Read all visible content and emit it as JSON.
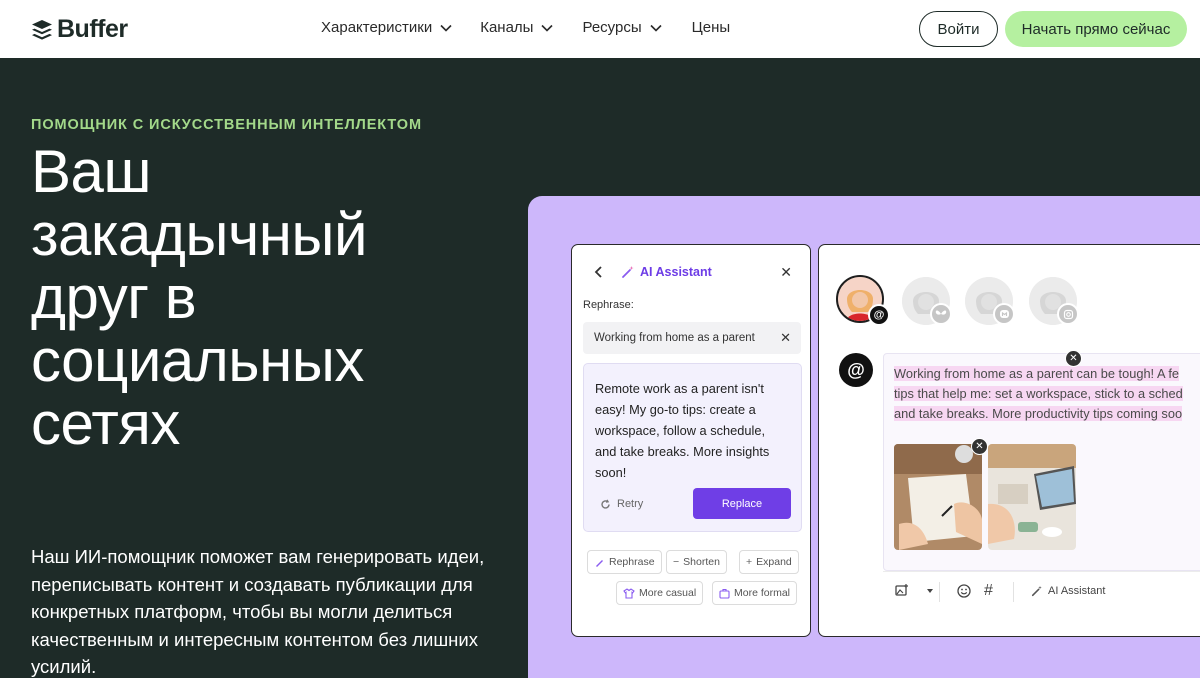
{
  "header": {
    "logo_text": "Buffer",
    "nav": [
      {
        "label": "Характеристики",
        "has_dropdown": true
      },
      {
        "label": "Каналы",
        "has_dropdown": true
      },
      {
        "label": "Ресурсы",
        "has_dropdown": true
      },
      {
        "label": "Цены",
        "has_dropdown": false
      }
    ],
    "login_label": "Войти",
    "cta_label": "Начать прямо сейчас"
  },
  "hero": {
    "eyebrow": "ПОМОЩНИК С ИСКУССТВЕННЫМ ИНТЕЛЛЕКТОМ",
    "title_lines": [
      "Ваш",
      "закадычный",
      "друг в",
      "социальных",
      "сетях"
    ],
    "description": "Наш ИИ-помощник поможет вам генерировать идеи, переписывать контент и создавать публикации для конкретных платформ, чтобы вы могли делиться качественным и интересным контентом без лишних усилий."
  },
  "ai_panel": {
    "title": "AI Assistant",
    "rephrase_label": "Rephrase:",
    "input_value": "Working from home as a parent",
    "result_text": "Remote work as a parent isn't easy! My go-to tips: create a workspace, follow a schedule, and take breaks. More insights soon!",
    "retry_label": "Retry",
    "replace_label": "Replace",
    "chips": [
      "Rephrase",
      "Shorten",
      "Expand",
      "More casual",
      "More formal"
    ]
  },
  "composer": {
    "post_lines": [
      "Working from home as a parent can be tough! A fe",
      "tips that help me: set a workspace, stick to a sched",
      "and take breaks. More productivity tips coming soo"
    ],
    "ai_button_label": "AI Assistant",
    "channels": [
      "threads",
      "bluesky",
      "mastodon",
      "instagram"
    ]
  },
  "colors": {
    "hero_bg": "#1e2b28",
    "accent_green": "#b5f0a0",
    "eyebrow_green": "#a3d98a",
    "visual_bg": "#cdb7fb",
    "ai_purple": "#6f3ee6"
  }
}
